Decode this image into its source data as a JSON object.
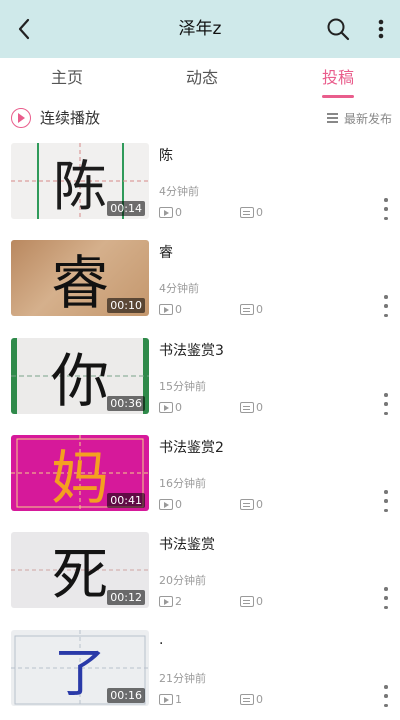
{
  "header": {
    "title": "泽年z",
    "bg_color": "#cfe9ea"
  },
  "tabs": [
    {
      "label": "主页",
      "active": false
    },
    {
      "label": "动态",
      "active": false
    },
    {
      "label": "投稿",
      "active": true
    }
  ],
  "accent_color": "#e95d8c",
  "toolbar": {
    "continuous_play_label": "连续播放",
    "sort_label": "最新发布"
  },
  "videos": [
    {
      "title": "陈",
      "time": "4分钟前",
      "plays": "0",
      "comments": "0",
      "duration": "00:14",
      "thumb_char": "陈",
      "thumb_theme": "grid-paper",
      "thumb_color": "#1c1c1c"
    },
    {
      "title": "睿",
      "time": "4分钟前",
      "plays": "0",
      "comments": "0",
      "duration": "00:10",
      "thumb_char": "睿",
      "thumb_theme": "wood",
      "thumb_color": "#111111"
    },
    {
      "title": "书法鉴赏3",
      "time": "15分钟前",
      "plays": "0",
      "comments": "0",
      "duration": "00:36",
      "thumb_char": "你",
      "thumb_theme": "green-frame",
      "thumb_color": "#141414"
    },
    {
      "title": "书法鉴赏2",
      "time": "16分钟前",
      "plays": "0",
      "comments": "0",
      "duration": "00:41",
      "thumb_char": "妈",
      "thumb_theme": "magenta",
      "thumb_color": "#f4a020"
    },
    {
      "title": "书法鉴赏",
      "time": "20分钟前",
      "plays": "2",
      "comments": "0",
      "duration": "00:12",
      "thumb_char": "死",
      "thumb_theme": "grid-paper",
      "thumb_color": "#141414"
    },
    {
      "title": ".",
      "time": "21分钟前",
      "plays": "1",
      "comments": "0",
      "duration": "00:16",
      "thumb_char": "了",
      "thumb_theme": "light-grid",
      "thumb_color": "#2a3aa8"
    }
  ],
  "icons": {
    "back": "chevron-left-icon",
    "search": "search-icon",
    "more": "more-vertical-icon",
    "play_circle": "play-circle-icon",
    "sort": "sort-lines-icon",
    "views": "play-count-icon",
    "comments": "comment-icon",
    "item_menu": "more-vertical-icon"
  }
}
